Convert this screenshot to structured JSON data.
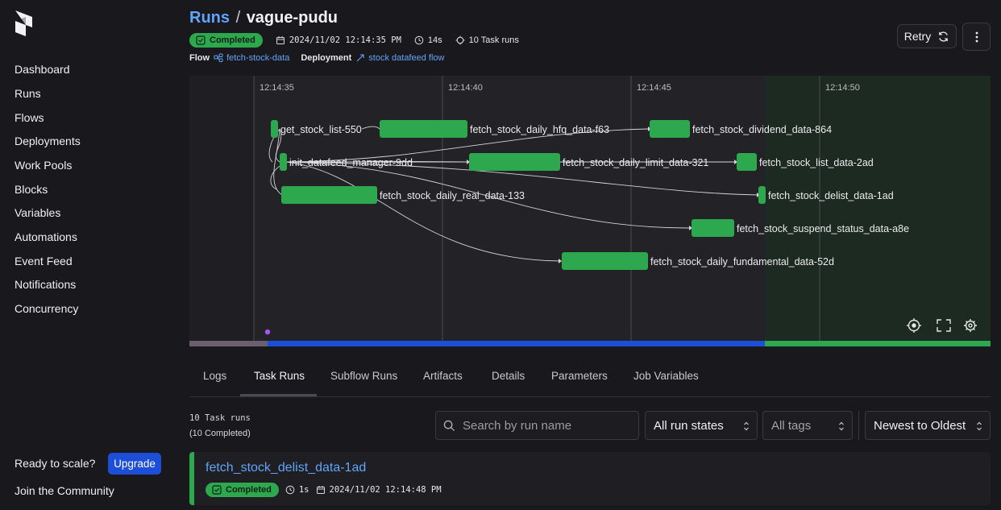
{
  "sidebar": {
    "items": [
      {
        "label": "Dashboard"
      },
      {
        "label": "Runs"
      },
      {
        "label": "Flows"
      },
      {
        "label": "Deployments"
      },
      {
        "label": "Work Pools"
      },
      {
        "label": "Blocks"
      },
      {
        "label": "Variables"
      },
      {
        "label": "Automations"
      },
      {
        "label": "Event Feed"
      },
      {
        "label": "Notifications"
      },
      {
        "label": "Concurrency"
      }
    ],
    "scale_text": "Ready to scale?",
    "upgrade_label": "Upgrade",
    "community_label": "Join the Community"
  },
  "header": {
    "breadcrumb_root": "Runs",
    "separator": "/",
    "run_name": "vague-pudu",
    "status": "Completed",
    "start_time": "2024/11/02 12:14:35 PM",
    "duration": "14s",
    "task_runs": "10 Task runs",
    "flow_label": "Flow",
    "flow_name": "fetch-stock-data",
    "deployment_label": "Deployment",
    "deployment_name": "stock datafeed flow",
    "retry_label": "Retry"
  },
  "graph": {
    "time_ticks": [
      "12:14:35",
      "12:14:40",
      "12:14:45",
      "12:14:50"
    ],
    "nodes": [
      {
        "label": "get_stock_list-550"
      },
      {
        "label": "fetch_stock_daily_hfq_data-f63"
      },
      {
        "label": "fetch_stock_dividend_data-864"
      },
      {
        "label": "init_datafeed_manager-9dd"
      },
      {
        "label": "fetch_stock_daily_limit_data-321"
      },
      {
        "label": "fetch_stock_list_data-2ad"
      },
      {
        "label": "fetch_stock_daily_real_data-133"
      },
      {
        "label": "fetch_stock_delist_data-1ad"
      },
      {
        "label": "fetch_stock_suspend_status_data-a8e"
      },
      {
        "label": "fetch_stock_daily_fundamental_data-52d"
      }
    ],
    "node_color": "#2ea84f",
    "edge_color": "#d4d4d8"
  },
  "tabs": [
    {
      "label": "Logs"
    },
    {
      "label": "Task Runs"
    },
    {
      "label": "Subflow Runs"
    },
    {
      "label": "Artifacts"
    },
    {
      "label": "Details"
    },
    {
      "label": "Parameters"
    },
    {
      "label": "Job Variables"
    }
  ],
  "task_runs": {
    "count_text": "10 Task runs",
    "completed_text": "(10 Completed)",
    "search_placeholder": "Search by run name",
    "state_filter": "All run states",
    "tags_filter": "All tags",
    "sort": "Newest to Oldest",
    "items": [
      {
        "name": "fetch_stock_delist_data-1ad",
        "status": "Completed",
        "duration": "1s",
        "start": "2024/11/02 12:14:48 PM"
      }
    ]
  },
  "colors": {
    "accent": "#60a5fa",
    "completed": "#2ea84f",
    "timeline_blue": "#1d4ed8"
  }
}
